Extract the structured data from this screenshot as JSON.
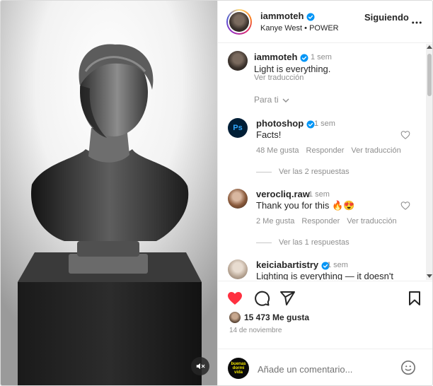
{
  "post": {
    "username": "iammoteh",
    "audio": "Kanye West • POWER",
    "follow_label": "Siguiendo",
    "caption": "Light is everything.",
    "caption_time": "1 sem",
    "translate_label": "Ver traducción",
    "filter_label": "Para ti",
    "likes": "15 473 Me gusta",
    "date": "14 de noviembre",
    "comment_placeholder": "Añade un comentario...",
    "my_avatar_text": "buenas dormi vida"
  },
  "comments": [
    {
      "username": "photoshop",
      "avatar_label": "Ps",
      "time": "1 sem",
      "text": "Facts!",
      "likes": "48 Me gusta",
      "reply_label": "Responder",
      "translate_label": "Ver traducción",
      "replies": "Ver las 2 respuestas"
    },
    {
      "username": "verocliq.raw",
      "time": "1 sem",
      "text": "Thank you for this 🔥😍",
      "likes": "2 Me gusta",
      "reply_label": "Responder",
      "translate_label": "Ver traducción",
      "replies": "Ver las 1 respuestas"
    },
    {
      "username": "keiciabartistry",
      "time": "1 sem",
      "text": "Lighting is everything — it doesn't"
    }
  ],
  "icons": {
    "verified_color": "#0095f6",
    "like_color": "#ff3040",
    "photoshop_color": "#001e36",
    "photoshop_text_color": "#31a8ff"
  }
}
